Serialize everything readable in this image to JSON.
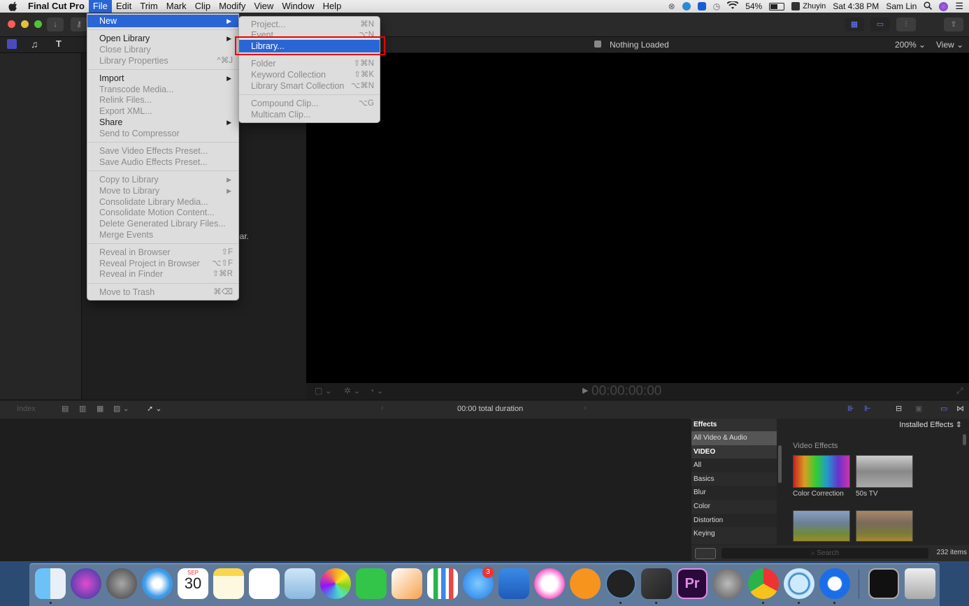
{
  "menubar": {
    "app": "Final Cut Pro",
    "items": [
      "File",
      "Edit",
      "Trim",
      "Mark",
      "Clip",
      "Modify",
      "View",
      "Window",
      "Help"
    ],
    "status": {
      "battery": "54%",
      "input": "Zhuyin",
      "clock": "Sat 4:38 PM",
      "user": "Sam Lin"
    }
  },
  "viewer": {
    "title": "Nothing Loaded",
    "zoom": "200%",
    "view": "View",
    "timecode": "00:00:00:00"
  },
  "browser": {
    "hint_fragment": "oar."
  },
  "timeline": {
    "index": "Index",
    "duration": "00:00 total duration"
  },
  "file_menu": {
    "items": [
      {
        "label": "New",
        "arrow": "▶",
        "state": "highlight"
      },
      {
        "label": "Open Library",
        "arrow": "▶"
      },
      {
        "label": "Close Library",
        "disabled": true
      },
      {
        "label": "Library Properties",
        "shortcut": "^⌘J",
        "disabled": true
      },
      {
        "label": "Import",
        "arrow": "▶"
      },
      {
        "label": "Transcode Media...",
        "disabled": true
      },
      {
        "label": "Relink Files...",
        "disabled": true
      },
      {
        "label": "Export XML...",
        "disabled": true
      },
      {
        "label": "Share",
        "arrow": "▶"
      },
      {
        "label": "Send to Compressor",
        "disabled": true
      },
      {
        "label": "Save Video Effects Preset...",
        "disabled": true
      },
      {
        "label": "Save Audio Effects Preset...",
        "disabled": true
      },
      {
        "label": "Copy to Library",
        "arrow": "▶",
        "disabled": true
      },
      {
        "label": "Move to Library",
        "arrow": "▶",
        "disabled": true
      },
      {
        "label": "Consolidate Library Media...",
        "disabled": true
      },
      {
        "label": "Consolidate Motion Content...",
        "disabled": true
      },
      {
        "label": "Delete Generated Library Files...",
        "disabled": true
      },
      {
        "label": "Merge Events",
        "disabled": true
      },
      {
        "label": "Reveal in Browser",
        "shortcut": "⇧F",
        "disabled": true
      },
      {
        "label": "Reveal Project in Browser",
        "shortcut": "⌥⇧F",
        "disabled": true
      },
      {
        "label": "Reveal in Finder",
        "shortcut": "⇧⌘R",
        "disabled": true
      },
      {
        "label": "Move to Trash",
        "shortcut": "⌘⌫",
        "disabled": true
      }
    ]
  },
  "new_submenu": {
    "items": [
      {
        "label": "Project...",
        "shortcut": "⌘N",
        "disabled": true
      },
      {
        "label": "Event...",
        "shortcut": "⌥N",
        "disabled": true
      },
      {
        "label": "Library...",
        "state": "highlight"
      },
      {
        "label": "Folder",
        "shortcut": "⇧⌘N",
        "disabled": true
      },
      {
        "label": "Keyword Collection",
        "shortcut": "⇧⌘K",
        "disabled": true
      },
      {
        "label": "Library Smart Collection",
        "shortcut": "⌥⌘N",
        "disabled": true
      },
      {
        "label": "Compound Clip...",
        "shortcut": "⌥G",
        "disabled": true
      },
      {
        "label": "Multicam Clip...",
        "disabled": true
      }
    ]
  },
  "effects": {
    "header": "Effects",
    "installed": "Installed Effects",
    "categories": [
      "All Video & Audio",
      "VIDEO",
      "All",
      "Basics",
      "Blur",
      "Color",
      "Distortion",
      "Keying"
    ],
    "section": "Video Effects",
    "items": [
      "Color Correction",
      "50s TV"
    ],
    "search_placeholder": "Search",
    "count": "232 items"
  },
  "dock": {
    "calendar_month": "SEP",
    "calendar_day": "30",
    "appstore_badge": "3",
    "premiere_label": "Pr"
  },
  "colors": {
    "accent": "#2a65d6",
    "highlight_box": "#e00000"
  }
}
